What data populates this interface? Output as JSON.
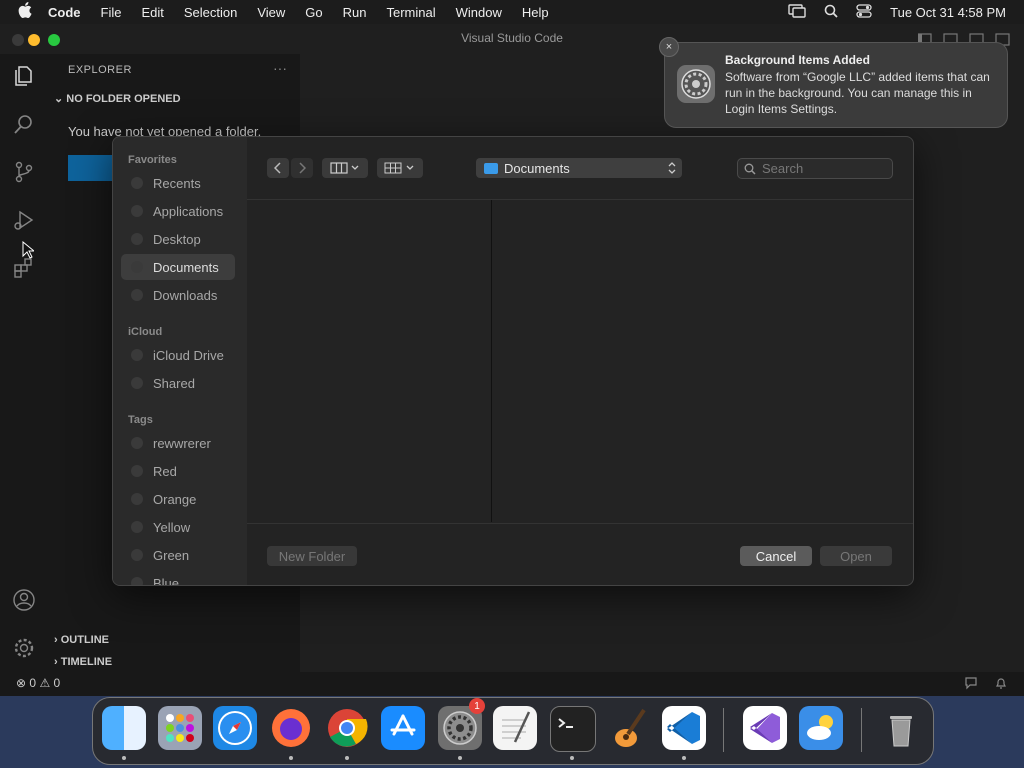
{
  "menubar": {
    "app": "Code",
    "items": [
      "File",
      "Edit",
      "Selection",
      "View",
      "Go",
      "Run",
      "Terminal",
      "Window",
      "Help"
    ],
    "clock": "Tue Oct 31  4:58 PM",
    "icons": [
      "apple-icon",
      "screen-mirroring-icon",
      "search-icon",
      "control-center-icon"
    ]
  },
  "window": {
    "title": "Visual Studio Code"
  },
  "sidebar": {
    "header": "EXPLORER",
    "more": "···",
    "no_folder": "NO FOLDER OPENED",
    "message": "You have not yet opened a folder.",
    "outline": "OUTLINE",
    "timeline": "TIMELINE"
  },
  "status": {
    "errors": "0",
    "warnings": "0"
  },
  "dialog": {
    "path": "Documents",
    "search_placeholder": "Search",
    "sections": {
      "favorites": "Favorites",
      "icloud": "iCloud",
      "tags": "Tags"
    },
    "favorites": [
      "Recents",
      "Applications",
      "Desktop",
      "Documents",
      "Downloads"
    ],
    "icloud_items": [
      "iCloud Drive",
      "Shared"
    ],
    "tags": [
      "rewwrerer",
      "Red",
      "Orange",
      "Yellow",
      "Green",
      "Blue"
    ],
    "buttons": {
      "new_folder": "New Folder",
      "cancel": "Cancel",
      "open": "Open"
    }
  },
  "notification": {
    "title": "Background Items Added",
    "body": "Software from “Google LLC” added items that can run in the background. You can manage this in Login Items Settings.",
    "close": "×"
  },
  "dock": {
    "apps": [
      "Finder",
      "Launchpad",
      "Safari",
      "Firefox",
      "Chrome",
      "App Store",
      "System Settings",
      "TextEdit",
      "Terminal",
      "GarageBand",
      "Visual Studio Code",
      "Visual Studio",
      "Weather",
      "Trash"
    ],
    "badge": "1"
  },
  "colors": {
    "accent": "#0e639c",
    "folder": "#3a9bea",
    "badge": "#e5413a"
  }
}
